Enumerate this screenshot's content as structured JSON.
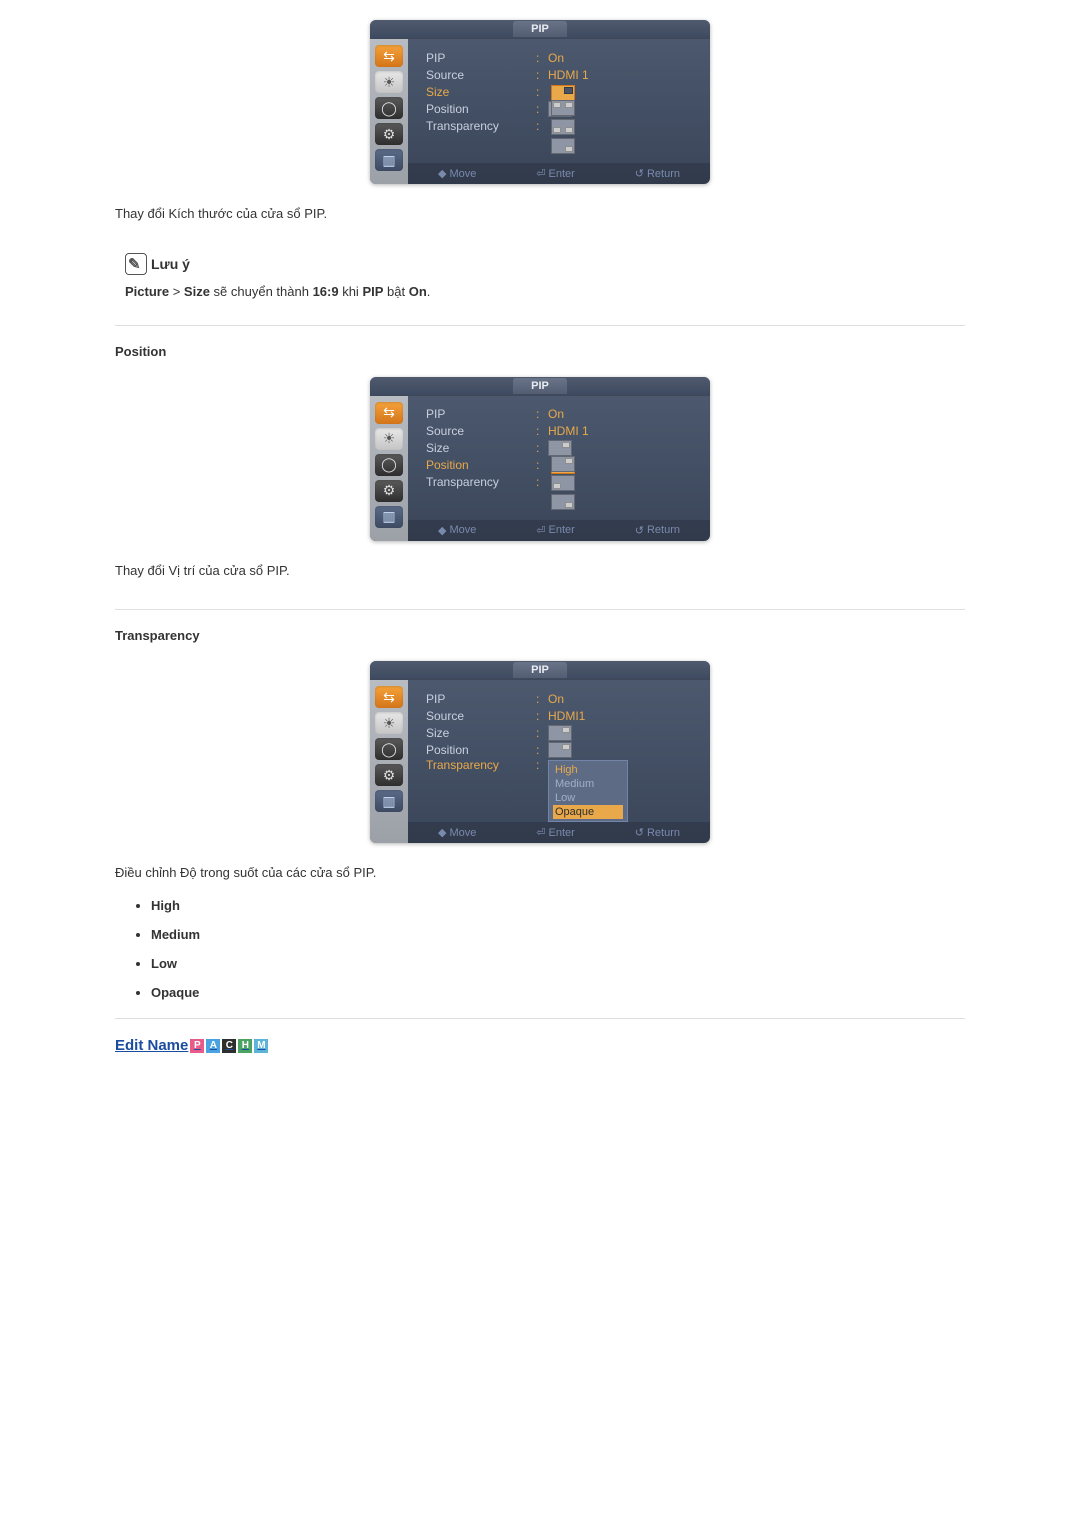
{
  "osd_title": "PIP",
  "menu": {
    "pip": "PIP",
    "source": "Source",
    "size": "Size",
    "position": "Position",
    "transparency": "Transparency"
  },
  "values": {
    "on": "On",
    "hdmi1": "HDMI 1",
    "hdmi1b": "HDMI1"
  },
  "footer": {
    "move": "Move",
    "enter": "Enter",
    "return": "Return"
  },
  "transparency_options": {
    "high": "High",
    "medium": "Medium",
    "low": "Low",
    "opaque": "Opaque"
  },
  "section1": {
    "desc": "Thay đổi Kích thước của cửa sổ PIP.",
    "note_title": "Lưu ý",
    "note_body_prefix": "Picture",
    "note_body_gt": " > ",
    "note_body_size": "Size",
    "note_body_mid": " sẽ chuyển thành ",
    "note_body_169": "16:9",
    "note_body_khi": " khi ",
    "note_body_pip": "PIP",
    "note_body_bat": " bật ",
    "note_body_on": "On",
    "note_body_end": "."
  },
  "section2": {
    "title": "Position",
    "desc": "Thay đổi Vị trí của cửa sổ PIP."
  },
  "section3": {
    "title": "Transparency",
    "desc": "Điều chỉnh Độ trong suốt của các cửa sổ PIP.",
    "options": [
      "High",
      "Medium",
      "Low",
      "Opaque"
    ]
  },
  "edit_name": "Edit Name",
  "badges": [
    "P",
    "A",
    "C",
    "H",
    "M"
  ]
}
